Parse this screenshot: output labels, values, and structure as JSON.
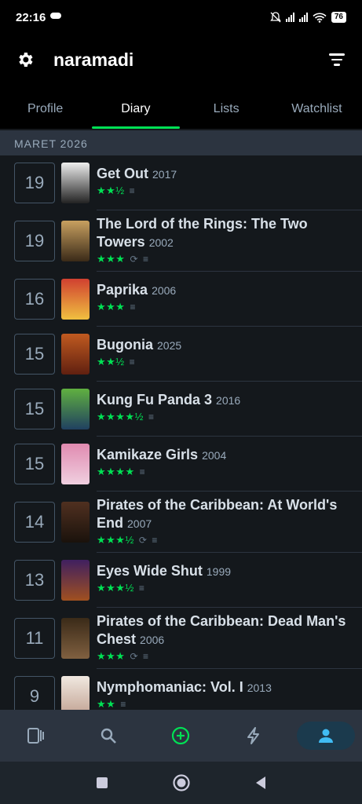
{
  "status_bar": {
    "time": "22:16",
    "battery": "76"
  },
  "header": {
    "title": "naramadi"
  },
  "tabs": [
    {
      "label": "Profile",
      "active": false
    },
    {
      "label": "Diary",
      "active": true
    },
    {
      "label": "Lists",
      "active": false
    },
    {
      "label": "Watchlist",
      "active": false
    }
  ],
  "month_label": "MARET 2026",
  "entries": [
    {
      "day": "19",
      "title": "Get Out",
      "year": "2017",
      "stars": "★★½",
      "rewatch": false,
      "review": true
    },
    {
      "day": "19",
      "title": "The Lord of the Rings: The Two Towers",
      "year": "2002",
      "stars": "★★★",
      "rewatch": true,
      "review": true
    },
    {
      "day": "16",
      "title": "Paprika",
      "year": "2006",
      "stars": "★★★",
      "rewatch": false,
      "review": true
    },
    {
      "day": "15",
      "title": "Bugonia",
      "year": "2025",
      "stars": "★★½",
      "rewatch": false,
      "review": true
    },
    {
      "day": "15",
      "title": "Kung Fu Panda 3",
      "year": "2016",
      "stars": "★★★★½",
      "rewatch": false,
      "review": true
    },
    {
      "day": "15",
      "title": "Kamikaze Girls",
      "year": "2004",
      "stars": "★★★★",
      "rewatch": false,
      "review": true
    },
    {
      "day": "14",
      "title": "Pirates of the Caribbean: At World's End",
      "year": "2007",
      "stars": "★★★½",
      "rewatch": true,
      "review": true
    },
    {
      "day": "13",
      "title": "Eyes Wide Shut",
      "year": "1999",
      "stars": "★★★½",
      "rewatch": false,
      "review": true
    },
    {
      "day": "11",
      "title": "Pirates of the Caribbean: Dead Man's Chest",
      "year": "2006",
      "stars": "★★★",
      "rewatch": true,
      "review": true
    },
    {
      "day": "9",
      "title": "Nymphomaniac: Vol. I",
      "year": "2013",
      "stars": "★★",
      "rewatch": false,
      "review": true
    }
  ],
  "bottom_nav": [
    {
      "icon": "films-icon",
      "active": false
    },
    {
      "icon": "search-icon",
      "active": false
    },
    {
      "icon": "add-icon",
      "active": false
    },
    {
      "icon": "activity-icon",
      "active": false
    },
    {
      "icon": "profile-icon",
      "active": true
    }
  ],
  "colors": {
    "accent": "#00e054",
    "background": "#14181c",
    "panel": "#2c3440",
    "muted": "#99aabb"
  }
}
